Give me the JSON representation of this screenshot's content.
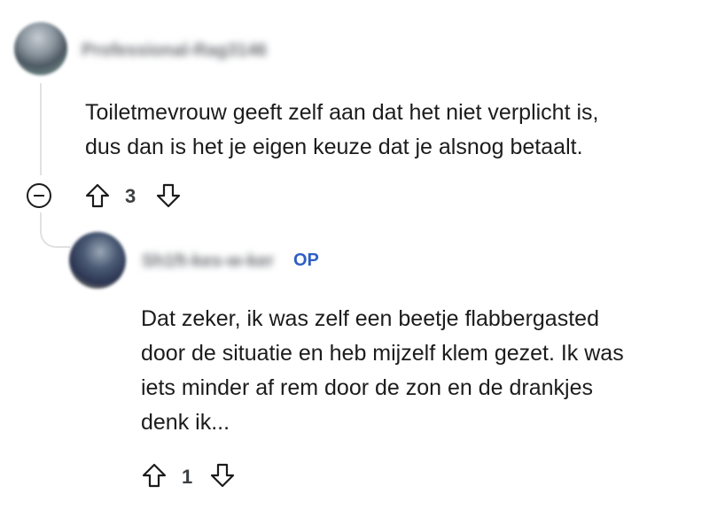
{
  "comments": [
    {
      "username": "Professional-Rag3146",
      "is_op": false,
      "body_lines": [
        "Toiletmevrouw geeft zelf aan dat het niet verplicht is,",
        "dus dan is het je eigen keuze dat je alsnog betaalt."
      ],
      "votes": "3",
      "icons": {
        "upvote": "upvote-arrow-icon",
        "downvote": "downvote-arrow-icon",
        "collapse": "minus-circle-icon"
      }
    },
    {
      "username": "Sh1ft-kes-w-ker",
      "is_op": true,
      "op_label": "OP",
      "body_lines": [
        "Dat zeker, ik was zelf een beetje flabbergasted",
        "door de situatie en heb mijzelf klem gezet. Ik was",
        "iets minder af rem door de zon en de drankjes",
        "denk ik..."
      ],
      "votes": "1",
      "icons": {
        "upvote": "upvote-arrow-icon",
        "downvote": "downvote-arrow-icon"
      }
    }
  ],
  "colors": {
    "op_badge": "#2f5fc4",
    "text": "#1c1c1c",
    "thread_line": "#dfe1e3"
  }
}
